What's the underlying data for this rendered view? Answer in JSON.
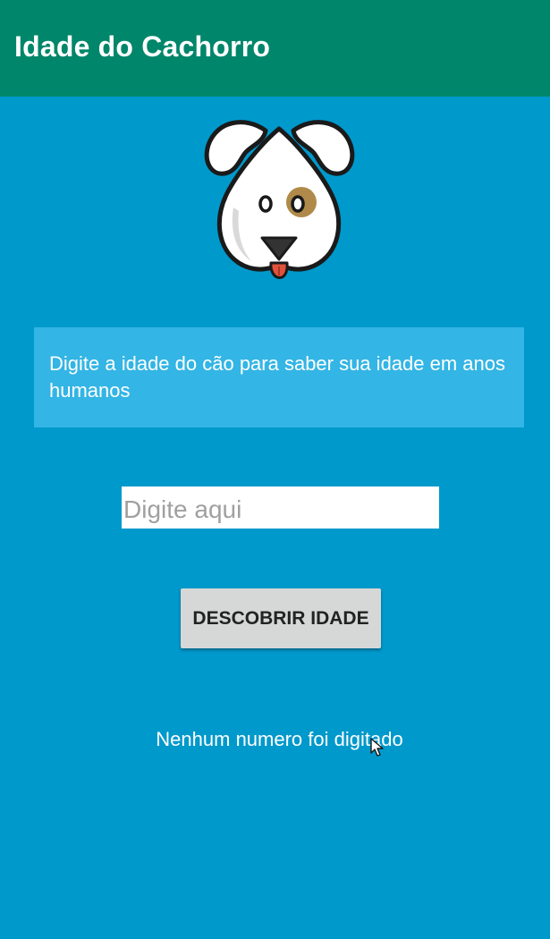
{
  "app_bar": {
    "title": "Idade do Cachorro",
    "color": "#00866A"
  },
  "main": {
    "background_color": "#0099CC",
    "logo_icon": "dog-face-icon",
    "info_box": {
      "text": "Digite a idade do cão para saber sua idade em anos humanos",
      "background_color": "#33B5E5"
    },
    "age_input": {
      "value": "",
      "placeholder": "Digite aqui"
    },
    "discover_button": {
      "label": "DESCOBRIR IDADE"
    },
    "result_text": "Nenhum numero foi digitado"
  }
}
